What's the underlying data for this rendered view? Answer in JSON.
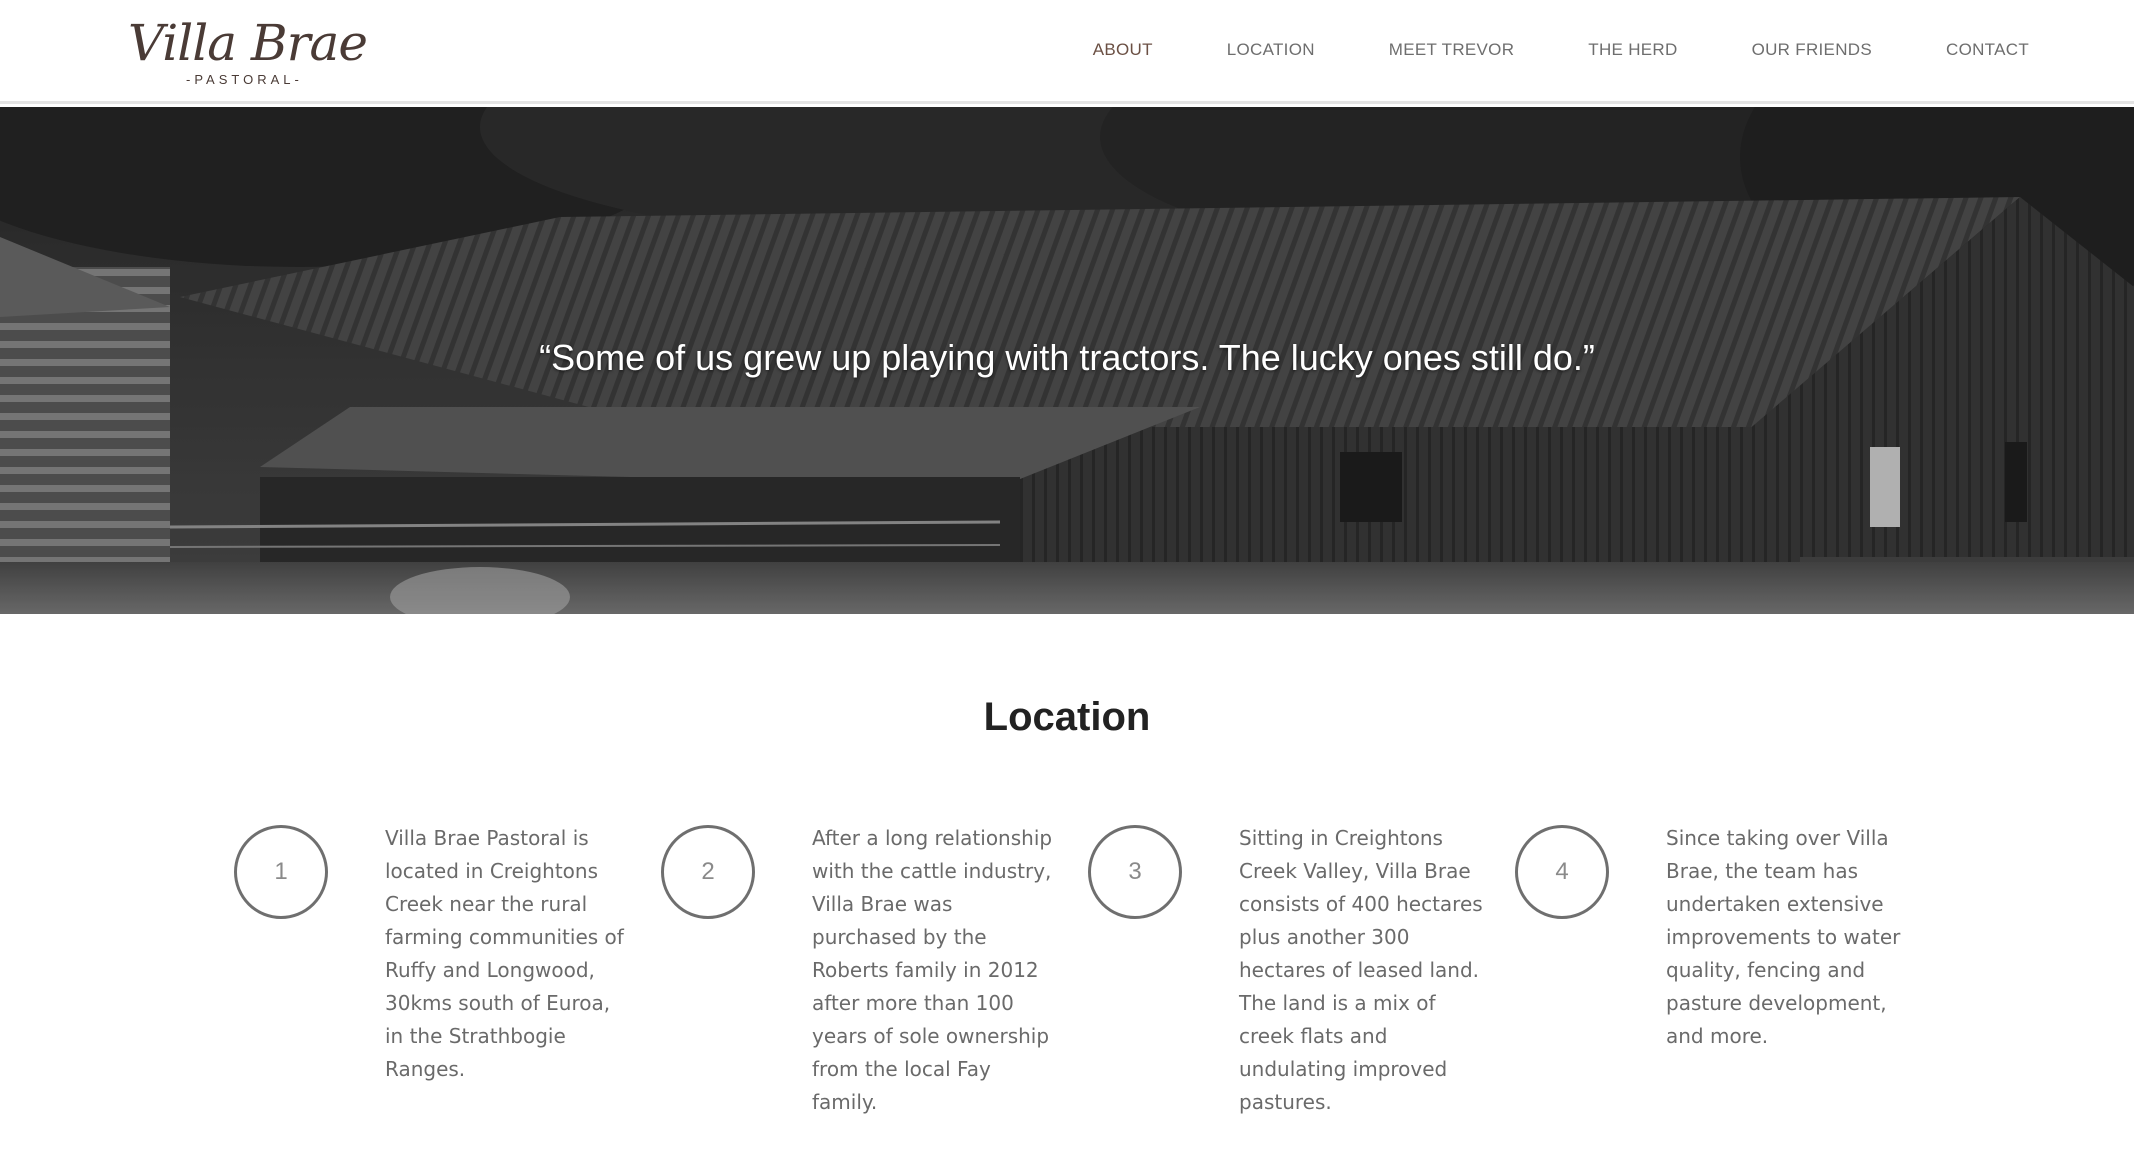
{
  "brand": {
    "name": "Villa Brae",
    "subtitle": "-PASTORAL-"
  },
  "nav": {
    "items": [
      "ABOUT",
      "LOCATION",
      "MEET TREVOR",
      "THE HERD",
      "OUR FRIENDS",
      "CONTACT"
    ],
    "active": "ABOUT"
  },
  "hero": {
    "quote": "“Some of us grew up playing with tractors. The lucky ones still do.”"
  },
  "location": {
    "title": "Location",
    "items": [
      {
        "number": "1",
        "text": "Villa Brae Pastoral is located in Creightons Creek near the rural farming communities of Ruffy and Longwood, 30kms south of Euroa, in the Strathbogie Ranges."
      },
      {
        "number": "2",
        "text": "After a long relationship with the cattle industry, Villa Brae was purchased by the Roberts family in 2012 after more than 100 years of sole ownership from the local Fay family."
      },
      {
        "number": "3",
        "text": "Sitting in Creightons Creek Valley, Villa Brae consists of 400 hectares plus another 300 hectares of leased land. The land is a mix of creek flats and undulating improved pastures."
      },
      {
        "number": "4",
        "text": "Since taking over Villa Brae, the team has undertaken extensive improvements to water quality, fencing and pasture development, and more."
      }
    ]
  },
  "colors": {
    "brand": "#4a3b36",
    "nav_active": "#6b5044",
    "nav": "#6e6e6e",
    "body_text": "#6a6a6a"
  }
}
